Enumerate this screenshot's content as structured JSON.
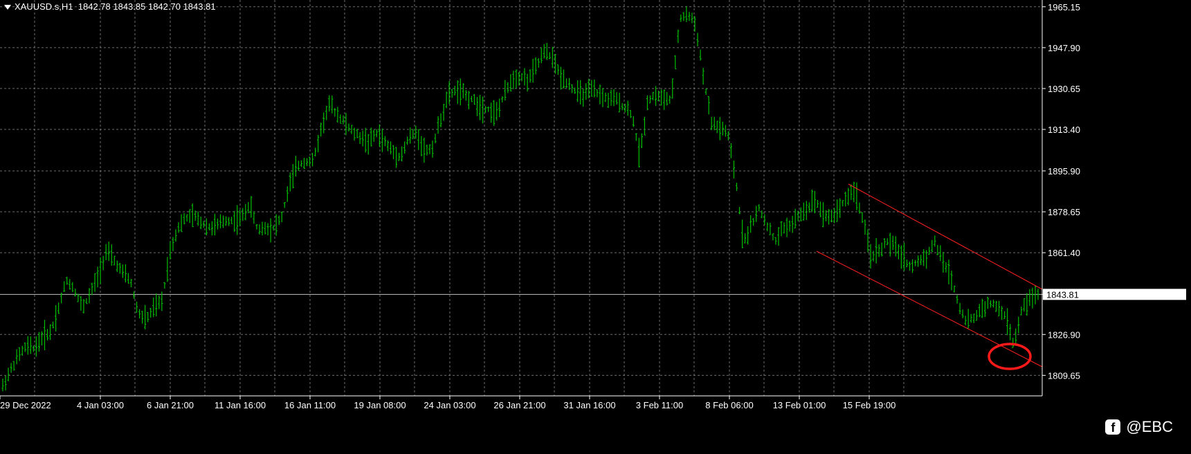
{
  "header": {
    "symbol": "XAUUSD.s,H1",
    "ohlc": "1842.78 1843.85 1842.70 1843.81"
  },
  "watermark": {
    "text": "@EBC",
    "icon": "facebook-icon"
  },
  "colors": {
    "background": "#000000",
    "grid": "#9a9a9a",
    "bars": "#00c000",
    "channel": "#ff2020",
    "circle": "#ff1a1a",
    "price_line": "#c0c0c0"
  },
  "chart_data": {
    "type": "bar",
    "title": "XAUUSD.s,H1",
    "ylim": [
      1801,
      1968
    ],
    "grid": true,
    "y_ticks": [
      "1965.15",
      "1947.90",
      "1930.65",
      "1913.40",
      "1895.90",
      "1878.65",
      "1861.40",
      "1843.81",
      "1826.90",
      "1809.65"
    ],
    "x_ticks": [
      "29 Dec 2022",
      "4 Jan 03:00",
      "6 Jan 21:00",
      "11 Jan 16:00",
      "16 Jan 11:00",
      "19 Jan 08:00",
      "24 Jan 03:00",
      "26 Jan 21:00",
      "31 Jan 16:00",
      "3 Feb 11:00",
      "8 Feb 06:00",
      "13 Feb 01:00",
      "15 Feb 19:00"
    ],
    "current_price": 1843.81,
    "series": [
      {
        "values": [
          1805,
          1812,
          1818,
          1822,
          1821,
          1826,
          1828,
          1838,
          1850,
          1846,
          1838,
          1844,
          1852,
          1862,
          1858,
          1853,
          1850,
          1836,
          1833,
          1838,
          1841,
          1862,
          1872,
          1876,
          1877,
          1874,
          1872,
          1873,
          1875,
          1875,
          1876,
          1882,
          1871,
          1872,
          1872,
          1876,
          1890,
          1898,
          1900,
          1900,
          1914,
          1924,
          1920,
          1916,
          1912,
          1910,
          1908,
          1912,
          1908,
          1904,
          1902,
          1910,
          1912,
          1904,
          1906,
          1918,
          1928,
          1930,
          1928,
          1926,
          1923,
          1922,
          1920,
          1928,
          1935,
          1936,
          1934,
          1940,
          1946,
          1944,
          1936,
          1933,
          1929,
          1928,
          1930,
          1928,
          1926,
          1926,
          1923,
          1920,
          1902,
          1926,
          1928,
          1926,
          1926,
          1960,
          1962,
          1958,
          1935,
          1916,
          1914,
          1912,
          1893,
          1866,
          1873,
          1880,
          1873,
          1866,
          1872,
          1873,
          1877,
          1880,
          1884,
          1878,
          1876,
          1880,
          1885,
          1888,
          1875,
          1860,
          1862,
          1866,
          1864,
          1860,
          1855,
          1858,
          1860,
          1866,
          1858,
          1852,
          1840,
          1832,
          1834,
          1838,
          1840,
          1838,
          1834,
          1822,
          1838,
          1842,
          1843.81
        ]
      }
    ],
    "annotations": [
      {
        "type": "trend_channel",
        "from": "8 Feb 06:00",
        "to": "15 Feb 19:00"
      },
      {
        "type": "circle",
        "at": "15 Feb 19:00"
      }
    ]
  }
}
